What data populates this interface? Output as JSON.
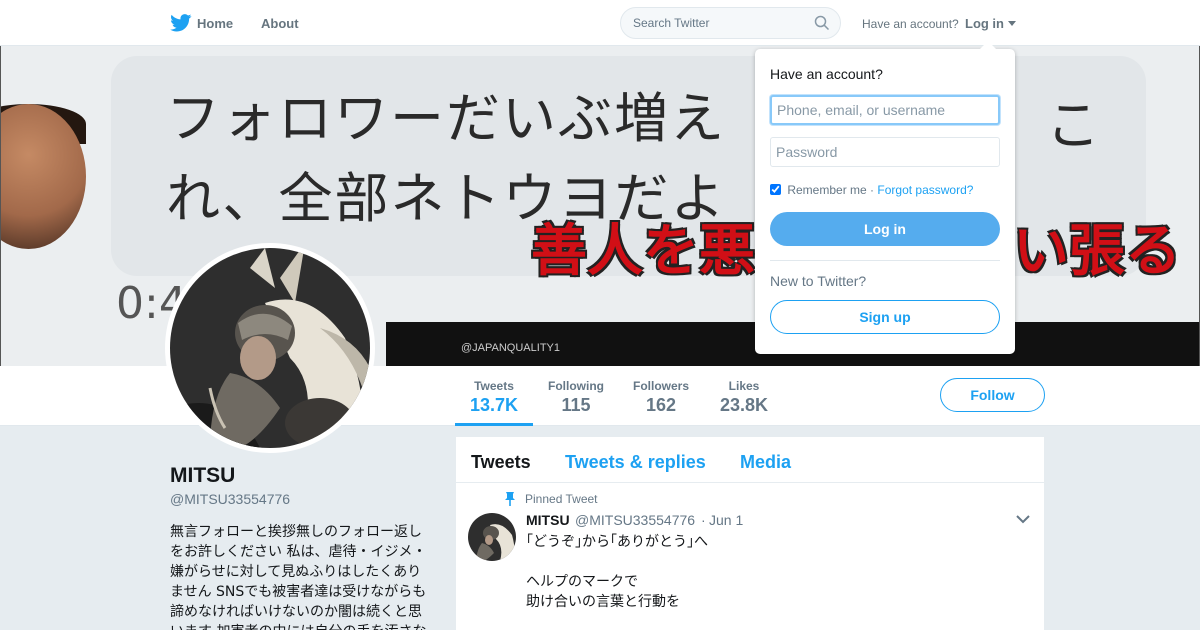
{
  "nav": {
    "home_label": "Home",
    "about_label": "About",
    "search_placeholder": "Search Twitter",
    "have_account": "Have an account?",
    "login_label": "Log in",
    "icons": {
      "logo": "twitter-bird-icon",
      "search": "search-icon",
      "caret": "caret-down-icon"
    },
    "brand_color": "#1DA1F2"
  },
  "banner": {
    "line1": "フォロワーだいぶ増え",
    "line1_end": "こ",
    "line2": "れ、全部ネトウヨだよ",
    "red_caption": "善人を悪",
    "red_caption_end": "い張る",
    "timer": "0:4",
    "strip_handle": "@JAPANQUALITY1"
  },
  "profile_nav": {
    "stats": [
      {
        "label": "Tweets",
        "value": "13.7K"
      },
      {
        "label": "Following",
        "value": "115"
      },
      {
        "label": "Followers",
        "value": "162"
      },
      {
        "label": "Likes",
        "value": "23.8K"
      }
    ],
    "follow_label": "Follow"
  },
  "profile": {
    "name": "MITSU",
    "handle": "@MITSU33554776",
    "bio": "無言フォローと挨拶無しのフォロー返しをお許しください 私は、虐待・イジメ・嫌がらせに対して見ぬふりはしたくありません SNSでも被害者達は受けながらも諦めなければいけないのか闇は続くと思います 加害者の中には自分の手を汚さな"
  },
  "timeline": {
    "tabs": [
      "Tweets",
      "Tweets & replies",
      "Media"
    ],
    "pinned_label": "Pinned Tweet",
    "tweet": {
      "name": "MITSU",
      "handle": "@MITSU33554776",
      "separator": "·",
      "date": "Jun 1",
      "lines": [
        "｢どうぞ｣から｢ありがとう｣へ",
        "",
        "ヘルプのマークで",
        "助け合いの言葉と行動を"
      ]
    }
  },
  "login_dropdown": {
    "title": "Have an account?",
    "username_placeholder": "Phone, email, or username",
    "password_placeholder": "Password",
    "remember_label": "Remember me",
    "separator": "·",
    "forgot_label": "Forgot password?",
    "login_button": "Log in",
    "new_label": "New to Twitter?",
    "signup_button": "Sign up"
  }
}
